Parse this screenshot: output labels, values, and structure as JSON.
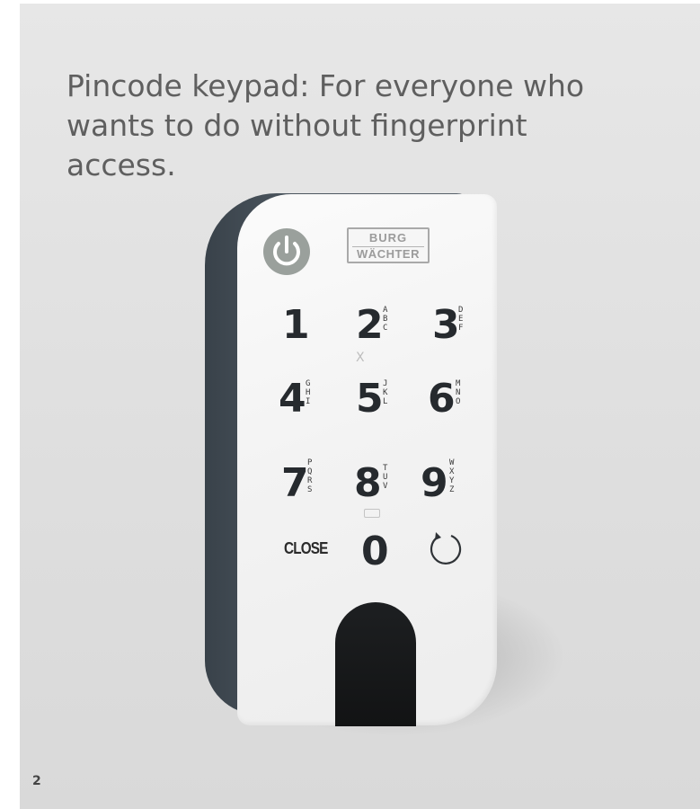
{
  "headline": "Pincode keypad: For everyone who wants to do without fingerprint access.",
  "page_number": "2",
  "device": {
    "brand_line1": "BURG",
    "brand_line2": "WÄCHTER",
    "keys": [
      {
        "digit": "1",
        "letters": ""
      },
      {
        "digit": "2",
        "letters": "ABC"
      },
      {
        "digit": "3",
        "letters": "DEF"
      },
      {
        "digit": "4",
        "letters": "GHI"
      },
      {
        "digit": "5",
        "letters": "JKL"
      },
      {
        "digit": "6",
        "letters": "MNO"
      },
      {
        "digit": "7",
        "letters": "PQRS"
      },
      {
        "digit": "8",
        "letters": "TUV"
      },
      {
        "digit": "9",
        "letters": "WXYZ"
      },
      {
        "digit": "0",
        "letters": ""
      }
    ],
    "close_label": "CLOSE",
    "x_mark": "X",
    "icons": [
      "power-icon",
      "refresh-icon",
      "fingerprint-sensor"
    ],
    "colors": {
      "face": "#f3f3f3",
      "body": "#4a545d",
      "power_icon": "#9aa09c",
      "sensor": "#151617"
    }
  }
}
